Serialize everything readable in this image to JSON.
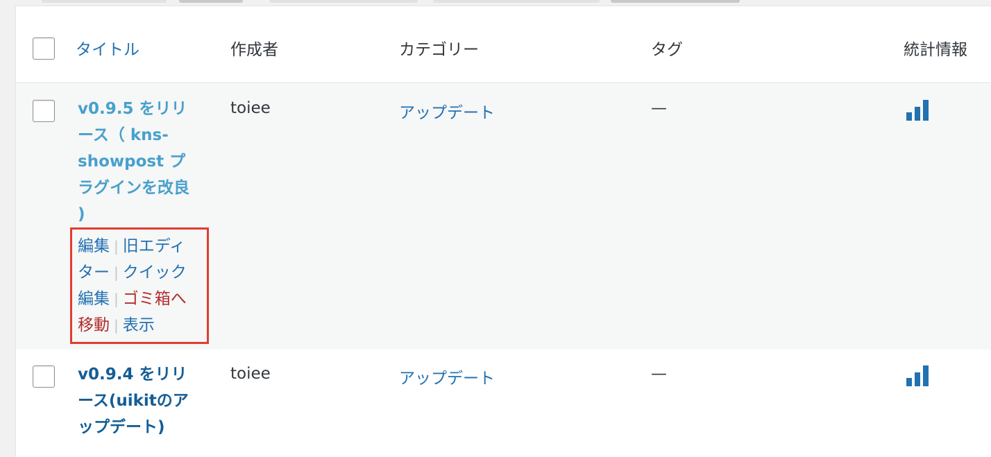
{
  "columns": {
    "title": "タイトル",
    "author": "作成者",
    "category": "カテゴリー",
    "tags": "タグ",
    "stats": "統計情報"
  },
  "rows": [
    {
      "title": "v0.9.5 をリリース（ kns-showpost プラグインを改良 )",
      "author": "toiee",
      "category": "アップデート",
      "tags": "—",
      "stats_icon": "bar-chart-icon",
      "row_actions": {
        "edit": "編集",
        "classic_editor": "旧エディター",
        "quick_edit": "クイック編集",
        "trash": "ゴミ箱へ移動",
        "view": "表示",
        "separator": "|"
      }
    },
    {
      "title": "v0.9.4 をリリース(uikitのアップデート)",
      "author": "toiee",
      "category": "アップデート",
      "tags": "—",
      "stats_icon": "bar-chart-icon"
    }
  ],
  "colors": {
    "link": "#2271b1",
    "link_hover": "#48a0cc",
    "danger": "#b32d2e",
    "highlight_box": "#e23c2f"
  }
}
